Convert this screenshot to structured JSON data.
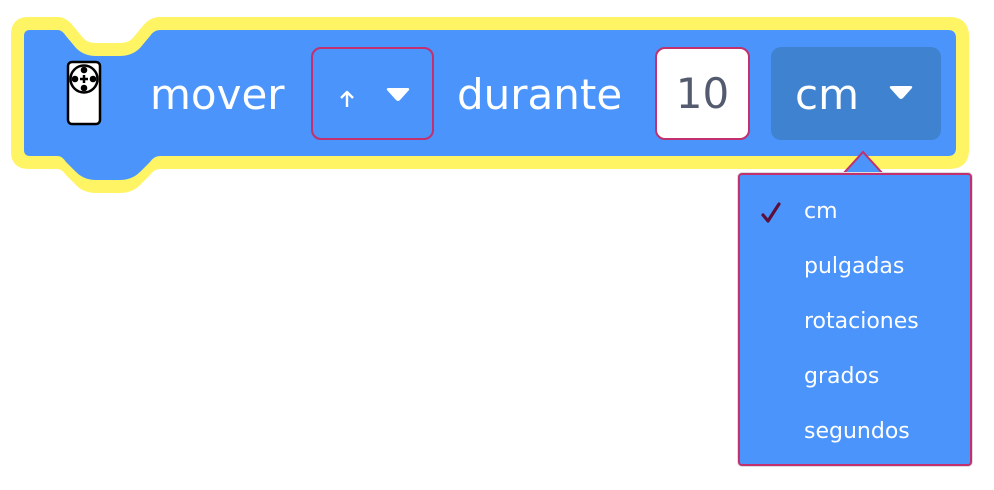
{
  "block": {
    "icon": "remote-control-icon",
    "verb_label": "mover",
    "direction_value": "↑",
    "connector_label": "durante",
    "amount_value": "10",
    "unit_value": "cm"
  },
  "unit_menu": {
    "selected": "cm",
    "options": [
      "cm",
      "pulgadas",
      "rotaciones",
      "grados",
      "segundos"
    ]
  },
  "colors": {
    "block_fill": "#4a94fb",
    "block_outline_highlight": "#fff463",
    "field_dark": "#3f82d0",
    "focus_border": "#c2306d",
    "check_mark": "#5b0f3a"
  }
}
